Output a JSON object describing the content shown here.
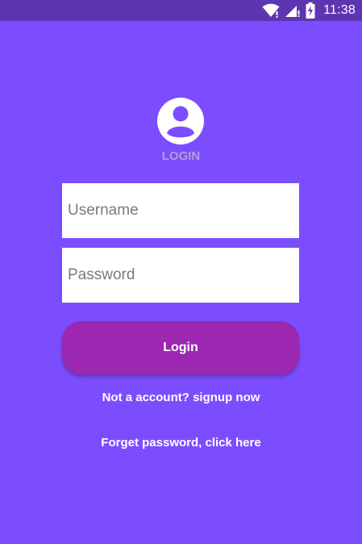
{
  "status_bar": {
    "time": "11:38",
    "icons": [
      "wifi-icon",
      "signal-icon",
      "battery-charging-icon"
    ]
  },
  "header": {
    "avatar_icon": "account-circle-icon",
    "title": "LOGIN"
  },
  "form": {
    "username_placeholder": "Username",
    "username_value": "",
    "password_placeholder": "Password",
    "password_value": "",
    "login_label": "Login"
  },
  "links": {
    "signup": "Not a account? signup now",
    "forgot": "Forget password, click here"
  },
  "colors": {
    "background": "#7c4dff",
    "status_bar": "#5e35b1",
    "button": "#9c27b0",
    "title": "#b39ddb"
  }
}
